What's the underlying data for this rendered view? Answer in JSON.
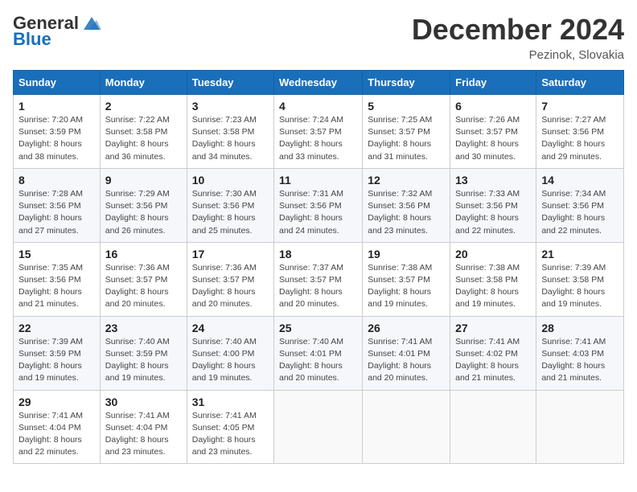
{
  "header": {
    "logo_general": "General",
    "logo_blue": "Blue",
    "month_title": "December 2024",
    "location": "Pezinok, Slovakia"
  },
  "weekdays": [
    "Sunday",
    "Monday",
    "Tuesday",
    "Wednesday",
    "Thursday",
    "Friday",
    "Saturday"
  ],
  "weeks": [
    [
      {
        "day": "1",
        "sunrise": "7:20 AM",
        "sunset": "3:59 PM",
        "daylight": "8 hours and 38 minutes."
      },
      {
        "day": "2",
        "sunrise": "7:22 AM",
        "sunset": "3:58 PM",
        "daylight": "8 hours and 36 minutes."
      },
      {
        "day": "3",
        "sunrise": "7:23 AM",
        "sunset": "3:58 PM",
        "daylight": "8 hours and 34 minutes."
      },
      {
        "day": "4",
        "sunrise": "7:24 AM",
        "sunset": "3:57 PM",
        "daylight": "8 hours and 33 minutes."
      },
      {
        "day": "5",
        "sunrise": "7:25 AM",
        "sunset": "3:57 PM",
        "daylight": "8 hours and 31 minutes."
      },
      {
        "day": "6",
        "sunrise": "7:26 AM",
        "sunset": "3:57 PM",
        "daylight": "8 hours and 30 minutes."
      },
      {
        "day": "7",
        "sunrise": "7:27 AM",
        "sunset": "3:56 PM",
        "daylight": "8 hours and 29 minutes."
      }
    ],
    [
      {
        "day": "8",
        "sunrise": "7:28 AM",
        "sunset": "3:56 PM",
        "daylight": "8 hours and 27 minutes."
      },
      {
        "day": "9",
        "sunrise": "7:29 AM",
        "sunset": "3:56 PM",
        "daylight": "8 hours and 26 minutes."
      },
      {
        "day": "10",
        "sunrise": "7:30 AM",
        "sunset": "3:56 PM",
        "daylight": "8 hours and 25 minutes."
      },
      {
        "day": "11",
        "sunrise": "7:31 AM",
        "sunset": "3:56 PM",
        "daylight": "8 hours and 24 minutes."
      },
      {
        "day": "12",
        "sunrise": "7:32 AM",
        "sunset": "3:56 PM",
        "daylight": "8 hours and 23 minutes."
      },
      {
        "day": "13",
        "sunrise": "7:33 AM",
        "sunset": "3:56 PM",
        "daylight": "8 hours and 22 minutes."
      },
      {
        "day": "14",
        "sunrise": "7:34 AM",
        "sunset": "3:56 PM",
        "daylight": "8 hours and 22 minutes."
      }
    ],
    [
      {
        "day": "15",
        "sunrise": "7:35 AM",
        "sunset": "3:56 PM",
        "daylight": "8 hours and 21 minutes."
      },
      {
        "day": "16",
        "sunrise": "7:36 AM",
        "sunset": "3:57 PM",
        "daylight": "8 hours and 20 minutes."
      },
      {
        "day": "17",
        "sunrise": "7:36 AM",
        "sunset": "3:57 PM",
        "daylight": "8 hours and 20 minutes."
      },
      {
        "day": "18",
        "sunrise": "7:37 AM",
        "sunset": "3:57 PM",
        "daylight": "8 hours and 20 minutes."
      },
      {
        "day": "19",
        "sunrise": "7:38 AM",
        "sunset": "3:57 PM",
        "daylight": "8 hours and 19 minutes."
      },
      {
        "day": "20",
        "sunrise": "7:38 AM",
        "sunset": "3:58 PM",
        "daylight": "8 hours and 19 minutes."
      },
      {
        "day": "21",
        "sunrise": "7:39 AM",
        "sunset": "3:58 PM",
        "daylight": "8 hours and 19 minutes."
      }
    ],
    [
      {
        "day": "22",
        "sunrise": "7:39 AM",
        "sunset": "3:59 PM",
        "daylight": "8 hours and 19 minutes."
      },
      {
        "day": "23",
        "sunrise": "7:40 AM",
        "sunset": "3:59 PM",
        "daylight": "8 hours and 19 minutes."
      },
      {
        "day": "24",
        "sunrise": "7:40 AM",
        "sunset": "4:00 PM",
        "daylight": "8 hours and 19 minutes."
      },
      {
        "day": "25",
        "sunrise": "7:40 AM",
        "sunset": "4:01 PM",
        "daylight": "8 hours and 20 minutes."
      },
      {
        "day": "26",
        "sunrise": "7:41 AM",
        "sunset": "4:01 PM",
        "daylight": "8 hours and 20 minutes."
      },
      {
        "day": "27",
        "sunrise": "7:41 AM",
        "sunset": "4:02 PM",
        "daylight": "8 hours and 21 minutes."
      },
      {
        "day": "28",
        "sunrise": "7:41 AM",
        "sunset": "4:03 PM",
        "daylight": "8 hours and 21 minutes."
      }
    ],
    [
      {
        "day": "29",
        "sunrise": "7:41 AM",
        "sunset": "4:04 PM",
        "daylight": "8 hours and 22 minutes."
      },
      {
        "day": "30",
        "sunrise": "7:41 AM",
        "sunset": "4:04 PM",
        "daylight": "8 hours and 23 minutes."
      },
      {
        "day": "31",
        "sunrise": "7:41 AM",
        "sunset": "4:05 PM",
        "daylight": "8 hours and 23 minutes."
      },
      null,
      null,
      null,
      null
    ]
  ],
  "labels": {
    "sunrise_prefix": "Sunrise: ",
    "sunset_prefix": "Sunset: ",
    "daylight_prefix": "Daylight: "
  }
}
